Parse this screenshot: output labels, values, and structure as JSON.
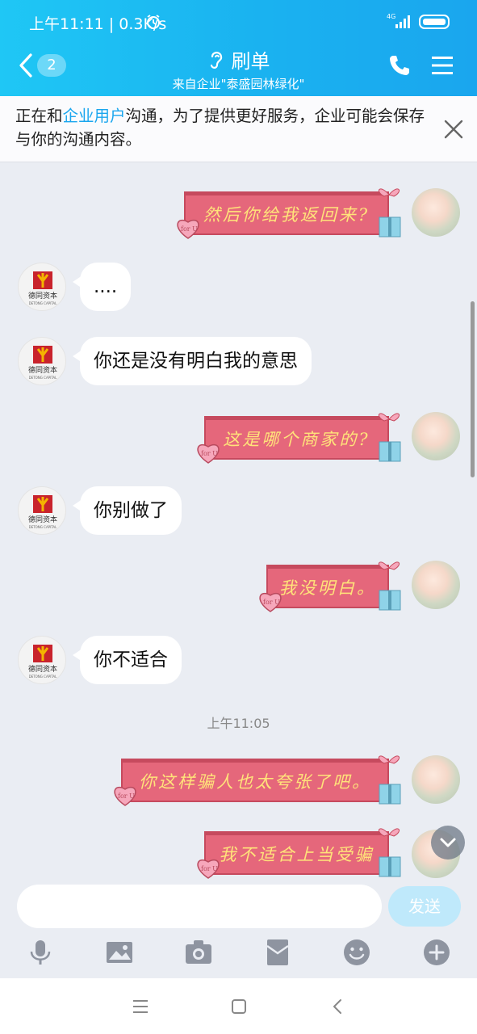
{
  "status_bar": {
    "time": "上午11:11 | 0.3K/s",
    "network": "4G"
  },
  "header": {
    "unread_count": "2",
    "title": "刷单",
    "subtitle": "来自企业\"泰盛园林绿化\""
  },
  "notice": {
    "text_before": "正在和",
    "highlight": "企业用户",
    "text_after": "沟通，为了提供更好服务，企业可能会保存与你的沟通内容。"
  },
  "company": {
    "avatar_name": "德同资本",
    "avatar_name_en": "DETONG CAPITAL"
  },
  "messages": [
    {
      "side": "right",
      "type": "sticker",
      "text": "然后你给我返回来?"
    },
    {
      "side": "left",
      "type": "text",
      "text": "...."
    },
    {
      "side": "left",
      "type": "text",
      "text": "你还是没有明白我的意思"
    },
    {
      "side": "right",
      "type": "sticker",
      "text": "这是哪个商家的?"
    },
    {
      "side": "left",
      "type": "text",
      "text": "你别做了"
    },
    {
      "side": "right",
      "type": "sticker",
      "text": "我没明白。"
    },
    {
      "side": "left",
      "type": "text",
      "text": "你不适合"
    },
    {
      "type": "timestamp",
      "text": "上午11:05"
    },
    {
      "side": "right",
      "type": "sticker",
      "text": "你这样骗人也太夸张了吧。"
    },
    {
      "side": "right",
      "type": "sticker",
      "text": "我不适合上当受骗"
    }
  ],
  "sticker_tag": "for U",
  "input": {
    "placeholder": "",
    "send_label": "发送"
  },
  "colors": {
    "accent": "#1ab2f0",
    "sticker": "#e5677b",
    "sticker_text": "#ffe37a"
  },
  "toolbar_icons": [
    "microphone-icon",
    "image-icon",
    "camera-icon",
    "red-packet-icon",
    "emoji-icon",
    "plus-icon"
  ],
  "system_nav_icons": [
    "menu-icon",
    "home-icon",
    "back-icon"
  ]
}
